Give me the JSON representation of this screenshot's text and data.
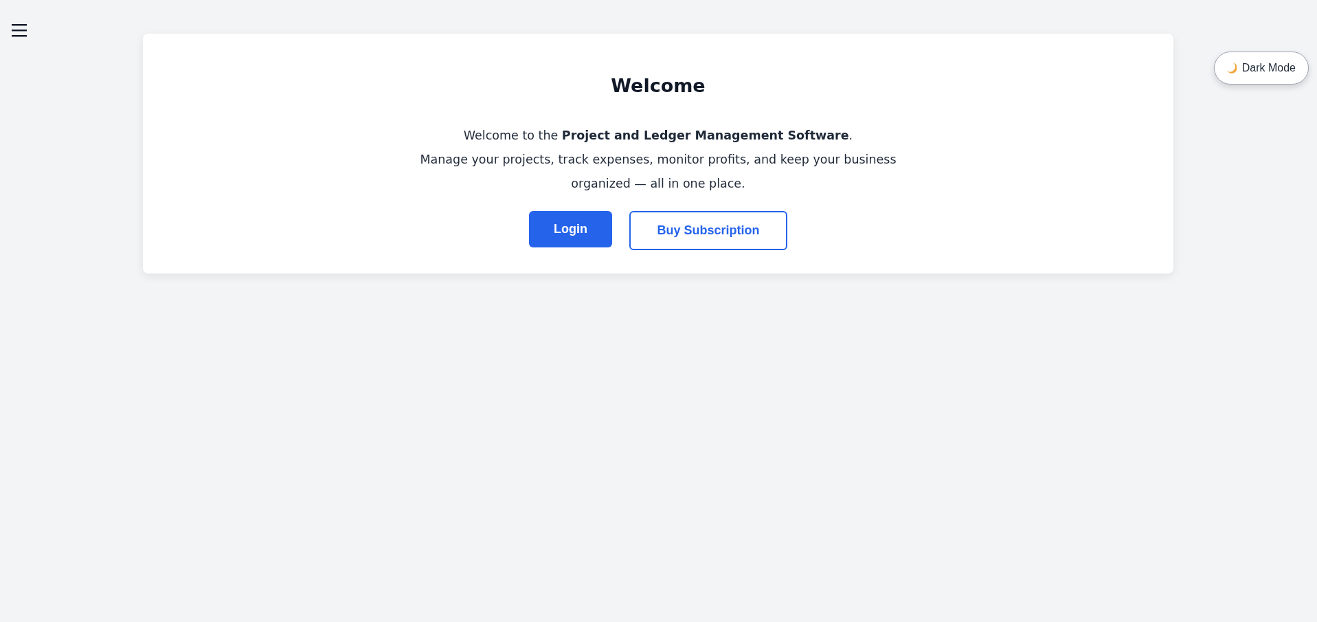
{
  "menu_button": {
    "kind": "hamburger"
  },
  "theme_toggle": {
    "label": "Dark Mode"
  },
  "card": {
    "title": "Welcome",
    "intro": "Welcome to the **Project and Ledger Management Software**.",
    "description": "Manage your projects, track expenses, monitor profits, and keep your business organized — all in one place.",
    "buttons": [
      {
        "label": "Login",
        "kind": "primary"
      },
      {
        "label": "Buy Subscription",
        "kind": "outline"
      }
    ]
  }
}
